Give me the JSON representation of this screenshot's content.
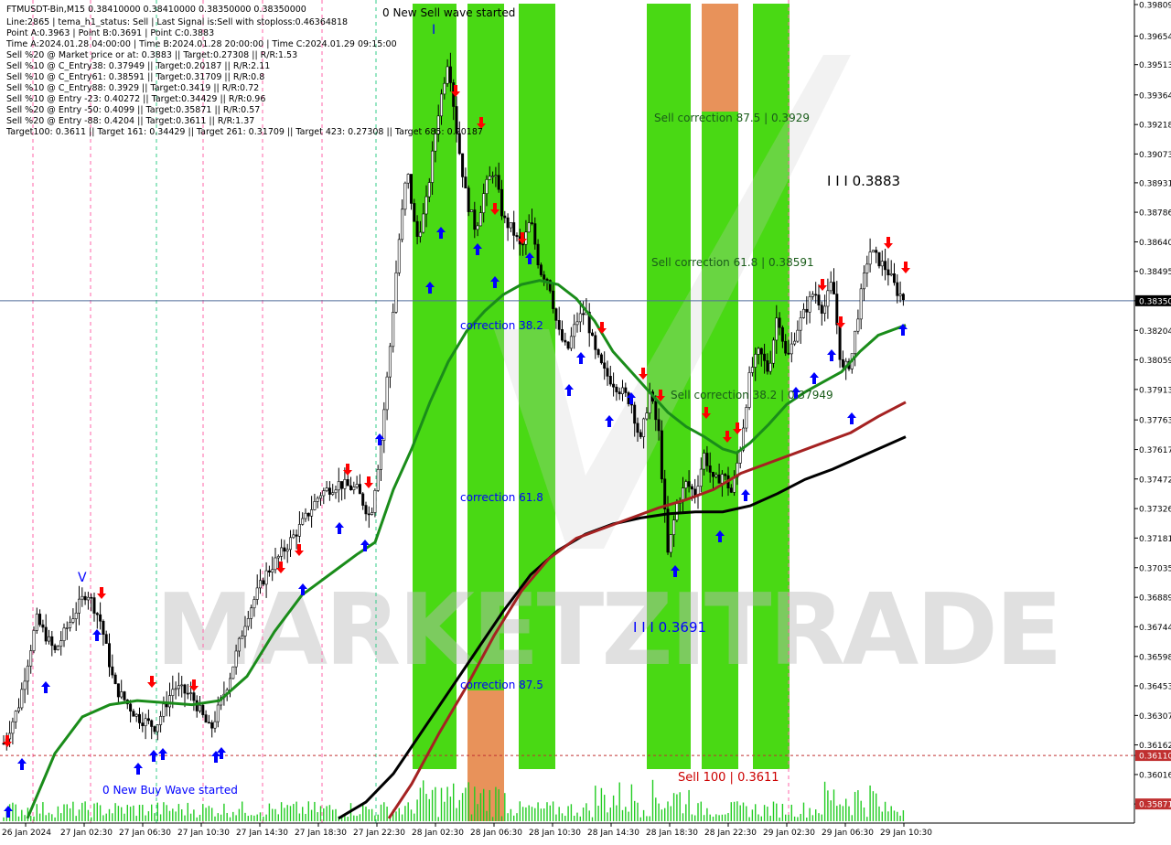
{
  "header": {
    "lines": [
      "FTMUSDT-Bin,M15  0.38410000 0.38410000 0.38350000 0.38350000",
      "Line:2865 | tema_h1_status: Sell | Last Signal is:Sell with stoploss:0.46364818",
      "Point A:0.3963 | Point B:0.3691 | Point C:0.3883",
      "Time A:2024.01.28 04:00:00 | Time B:2024.01.28 20:00:00 | Time C:2024.01.29 09:15:00",
      "Sell %20 @ Market price or at: 0.3883 || Target:0.27308 || R/R:1.53",
      "Sell %10 @ C_Entry38: 0.37949 || Target:0.20187 || R/R:2.11",
      "Sell %10 @ C_Entry61: 0.38591 || Target:0.31709 || R/R:0.8",
      "Sell %10 @ C_Entry88: 0.3929 || Target:0.3419 || R/R:0.72",
      "Sell %10 @ Entry -23: 0.40272 || Target:0.34429 || R/R:0.96",
      "Sell %20 @ Entry -50: 0.4099 || Target:0.35871 || R/R:0.57",
      "Sell %20 @ Entry -88: 0.4204 || Target:0.3611 || R/R:1.37",
      "Target100: 0.3611 || Target 161: 0.34429 || Target 261: 0.31709 || Target 423: 0.27308 || Target 685: 0.20187"
    ]
  },
  "watermark": "MARKETZITRADE",
  "chart_data": {
    "type": "candlestick",
    "symbol": "FTMUSDT-Bin",
    "timeframe": "M15",
    "ylim": [
      0.35795,
      0.39809
    ],
    "y_ticks": [
      "0.39809",
      "0.39654",
      "0.39513",
      "0.39364",
      "0.39218",
      "0.39073",
      "0.38931",
      "0.38786",
      "0.38640",
      "0.38495",
      "0.38350",
      "0.38204",
      "0.38059",
      "0.37913",
      "0.37763",
      "0.37617",
      "0.37472",
      "0.37326",
      "0.37181",
      "0.37035",
      "0.36889",
      "0.36744",
      "0.36598",
      "0.36453",
      "0.36307",
      "0.36162",
      "0.36110",
      "0.36016",
      "0.35871"
    ],
    "current_price": "0.38350",
    "current_price_value": 0.3835,
    "sell100_value": 0.3611,
    "x_labels": [
      "26 Jan 2024",
      "27 Jan 02:30",
      "27 Jan 06:30",
      "27 Jan 10:30",
      "27 Jan 14:30",
      "27 Jan 18:30",
      "27 Jan 22:30",
      "28 Jan 02:30",
      "28 Jan 06:30",
      "28 Jan 10:30",
      "28 Jan 14:30",
      "28 Jan 18:30",
      "28 Jan 22:30",
      "29 Jan 02:30",
      "29 Jan 06:30",
      "29 Jan 10:30"
    ],
    "annotations": {
      "sell_wave": "0 New Sell wave started",
      "buy_wave": "0 New Buy Wave started",
      "point_c": "I I I 0.3883",
      "point_b": "I I I 0.3691",
      "sell_corr_875": "Sell correction 87.5 | 0.3929",
      "sell_corr_618": "Sell correction 61.8 | 0.38591",
      "sell_corr_382": "Sell correction 38.2 | 0.37949",
      "corr_382": "correction 38.2",
      "corr_618": "correction 61.8",
      "corr_875": "correction 87.5",
      "sell100": "Sell 100 | 0.3611",
      "point_a_mark": "I",
      "buy_low_mark": "V"
    },
    "colors": {
      "zone_green": "#39d600",
      "zone_orange": "#e8925a",
      "ma_green": "#1a8c1a",
      "ma_red": "#a52222",
      "ma_black": "#000000",
      "arrow_buy": "#0000ff",
      "arrow_sell": "#ff0000",
      "volume": "#22cc22",
      "current_line": "#506e9a",
      "sell100_line": "#c03030",
      "text_blue": "#0000ff",
      "text_dark_green": "#1a5c1a",
      "text_red": "#cc0000"
    },
    "grid": false,
    "legend": "none"
  }
}
